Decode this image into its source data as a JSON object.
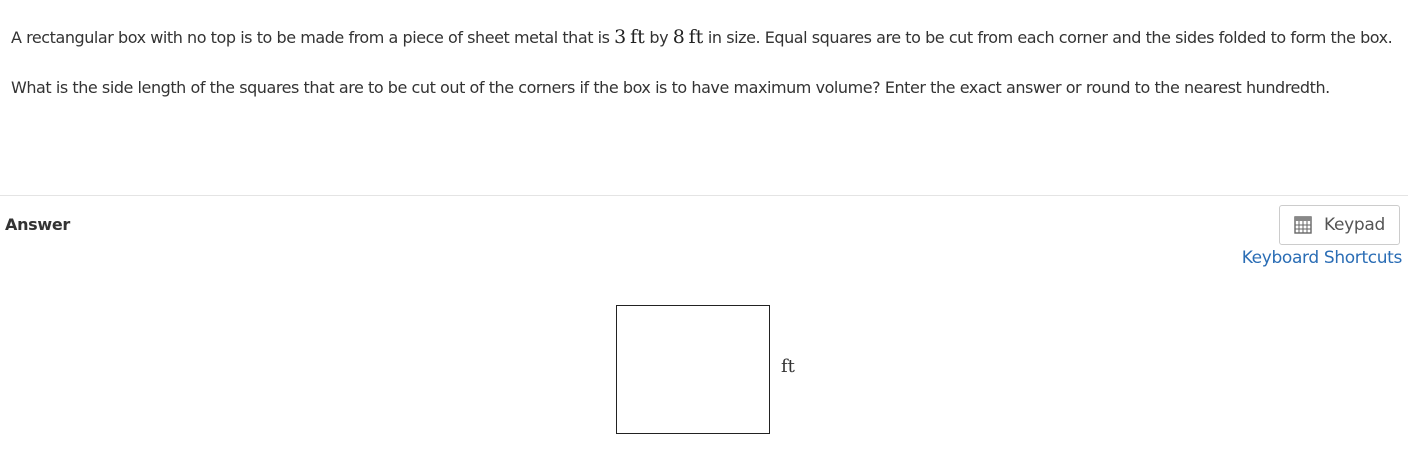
{
  "question": {
    "p1_part1": "A rectangular box with no top is to be made from a piece of sheet metal that is ",
    "p1_num1": "3",
    "p1_unit1": "ft",
    "p1_part2": " by ",
    "p1_num2": "8",
    "p1_unit2": "ft",
    "p1_part3": " in size.  Equal squares are to be cut from each corner and the sides folded to form the box.",
    "p2": "What is the side length of the squares that are to be cut out of the corners if the box is to have maximum volume? Enter the exact answer or round to the nearest hundredth."
  },
  "answer": {
    "label": "Answer",
    "unit": "ft",
    "value": ""
  },
  "keypad": {
    "label": "Keypad",
    "icon": "calculator-icon"
  },
  "keyboard_shortcuts": {
    "label": "Keyboard Shortcuts"
  }
}
